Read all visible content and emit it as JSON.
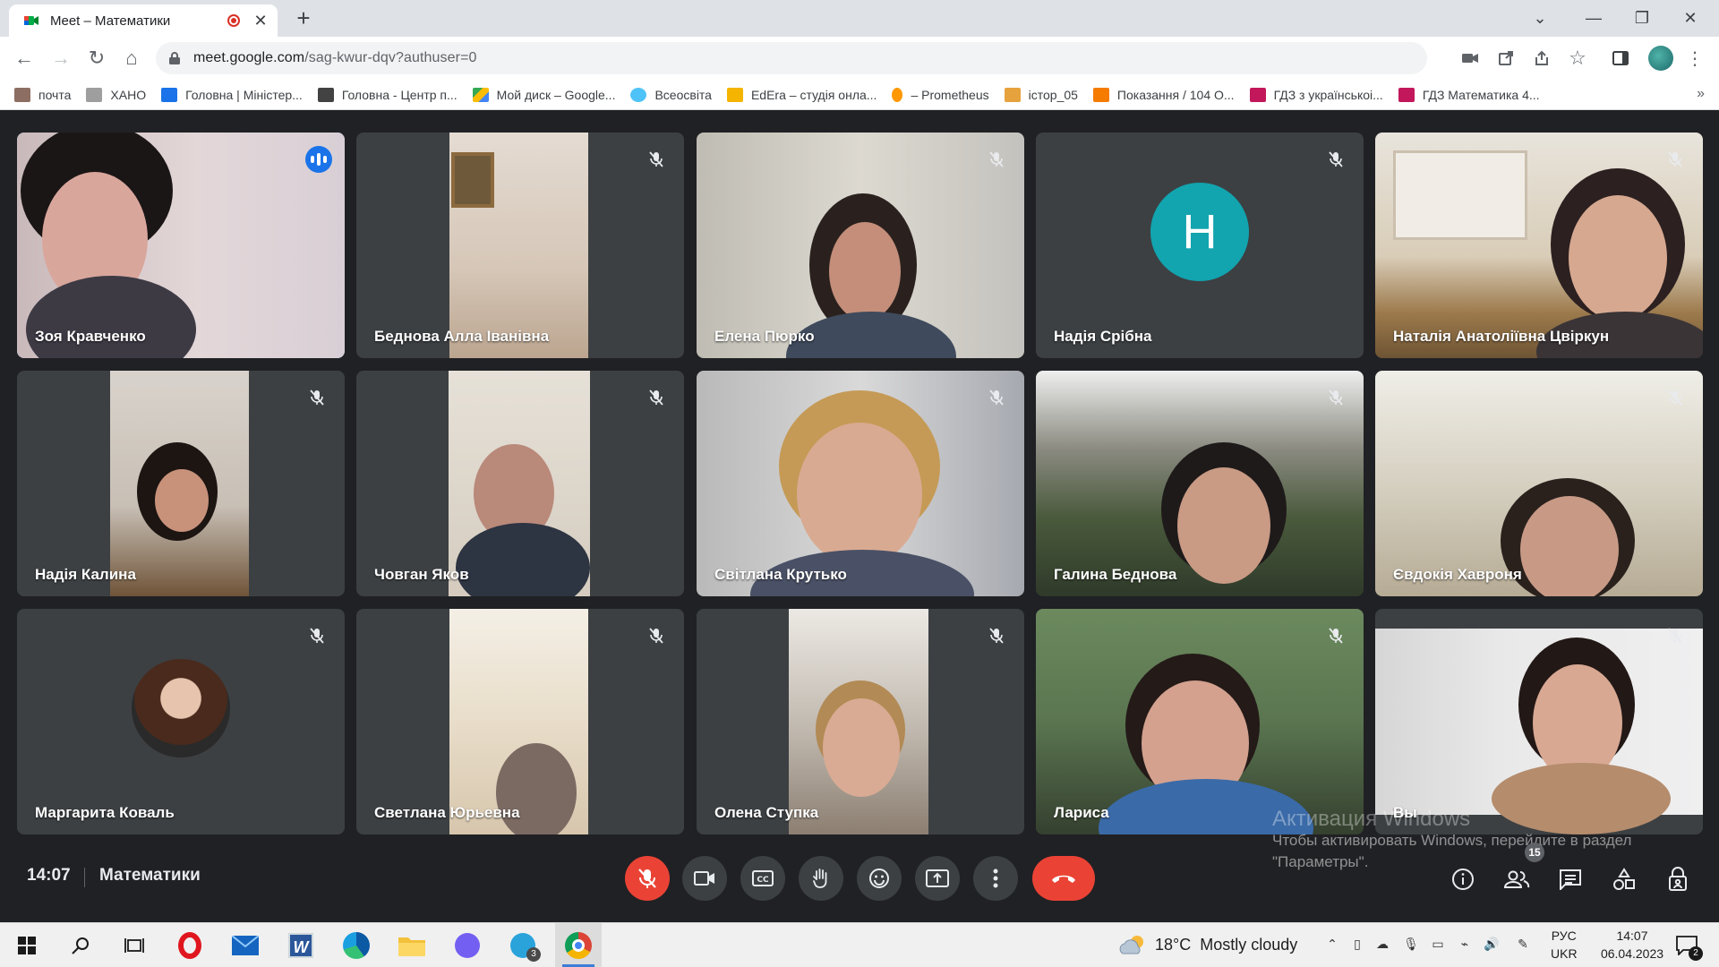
{
  "browser": {
    "tab_title": "Meet – Математики",
    "url_host": "meet.google.com",
    "url_path": "/sag-kwur-dqv?authuser=0"
  },
  "bookmarks": [
    {
      "label": "почта",
      "color": "#8d6e63"
    },
    {
      "label": "ХАНО",
      "color": "#9e9e9e"
    },
    {
      "label": "Головна | Міністер...",
      "color": "#1a73e8"
    },
    {
      "label": "Головна - Центр п...",
      "color": "#424242"
    },
    {
      "label": "Мой диск – Google...",
      "color": "#fbbc04"
    },
    {
      "label": "Всеосвіта",
      "color": "#4fc3f7"
    },
    {
      "label": "EdEra – студія онла...",
      "color": "#f4b400"
    },
    {
      "label": "– Prometheus",
      "color": "#ff9800"
    },
    {
      "label": "істор_05",
      "color": "#e6a23c"
    },
    {
      "label": "Показання / 104 О...",
      "color": "#f57c00"
    },
    {
      "label": "ГДЗ з українськоі...",
      "color": "#c2185b"
    },
    {
      "label": "ГДЗ Математика 4...",
      "color": "#c2185b"
    }
  ],
  "participants": [
    {
      "name": "Зоя Кравченко",
      "speaking": true
    },
    {
      "name": "Беднова Алла Іванівна",
      "muted": true
    },
    {
      "name": "Елена Пюрко",
      "muted": true
    },
    {
      "name": "Надія Срібна",
      "muted": true,
      "initial": "Н"
    },
    {
      "name": "Наталія Анатоліївна Цвіркун",
      "muted": true
    },
    {
      "name": "Надія Калина",
      "muted": true
    },
    {
      "name": "Човган Яков",
      "muted": true
    },
    {
      "name": "Світлана Крутько",
      "muted": true
    },
    {
      "name": "Галина Беднова",
      "muted": true
    },
    {
      "name": "Євдокія Хавроня",
      "muted": true
    },
    {
      "name": "Маргарита Коваль",
      "muted": true
    },
    {
      "name": "Светлана Юрьевна",
      "muted": true
    },
    {
      "name": "Олена Ступка",
      "muted": true
    },
    {
      "name": "Лариса",
      "muted": true
    },
    {
      "name": "Вы",
      "muted": true
    }
  ],
  "meeting": {
    "time": "14:07",
    "title": "Математики",
    "participant_count": "15"
  },
  "windows_activation": {
    "title": "Активация Windows",
    "line1": "Чтобы активировать Windows, перейдите в раздел",
    "line2": "\"Параметры\"."
  },
  "taskbar": {
    "weather_temp": "18°C",
    "weather_text": "Mostly cloudy",
    "lang_top": "РУС",
    "lang_bottom": "UKR",
    "time": "14:07",
    "date": "06.04.2023",
    "telegram_badge": "3",
    "notif_badge": "2"
  },
  "colors": {
    "meet_bg": "#202124",
    "tile_bg": "#3c4043",
    "accent_blue": "#1a73e8",
    "danger_red": "#ea4335",
    "avatar_teal": "#12a4af"
  }
}
